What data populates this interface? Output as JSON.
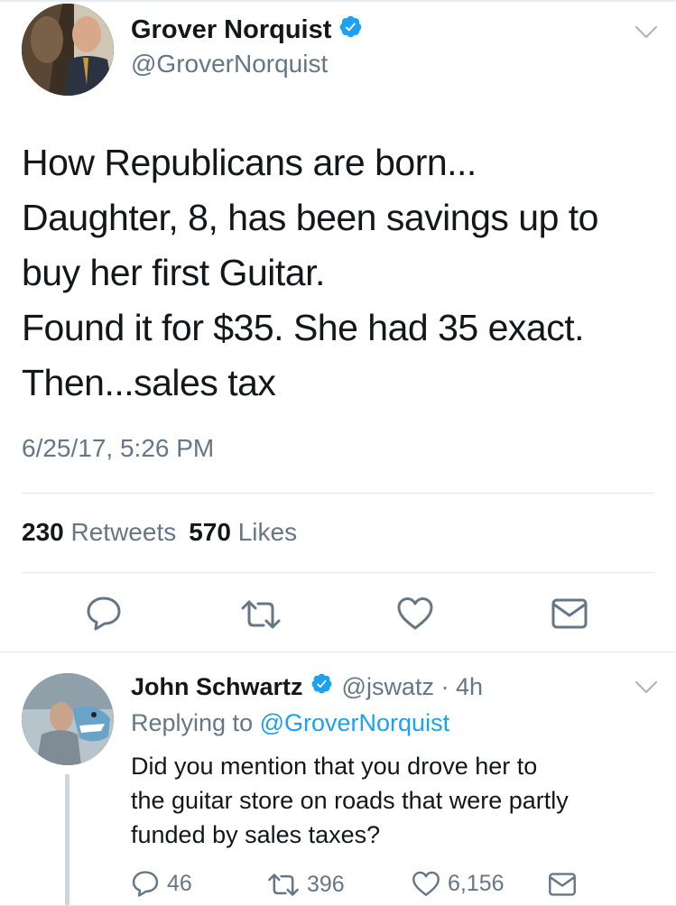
{
  "main_tweet": {
    "author_name": "Grover Norquist",
    "author_handle": "@GroverNorquist",
    "verified": true,
    "text_lines": [
      "How Republicans are born...",
      "Daughter, 8, has been savings up to",
      "buy her first Guitar.",
      "Found it for $35.  She had 35 exact.",
      "Then...sales tax"
    ],
    "timestamp": "6/25/17, 5:26 PM",
    "retweets_count": "230",
    "retweets_label": "Retweets",
    "likes_count": "570",
    "likes_label": "Likes"
  },
  "reply_tweet": {
    "author_name": "John Schwartz",
    "verified": true,
    "handle_time": "@jswatz · 4h",
    "replying_prefix": "Replying to",
    "replying_to": "@GroverNorquist",
    "text_lines": [
      "Did you mention that you drove her to",
      "the guitar store on roads that were partly",
      "funded by sales taxes?"
    ],
    "reply_count": "46",
    "retweet_count": "396",
    "like_count": "6,156"
  },
  "colors": {
    "accent": "#1da1f2",
    "secondary_text": "#657786",
    "primary_text": "#14171a",
    "divider": "#e1e8ed"
  },
  "icons": [
    "verified-badge-icon",
    "chevron-down-icon",
    "reply-icon",
    "retweet-icon",
    "like-heart-icon",
    "direct-message-icon"
  ]
}
